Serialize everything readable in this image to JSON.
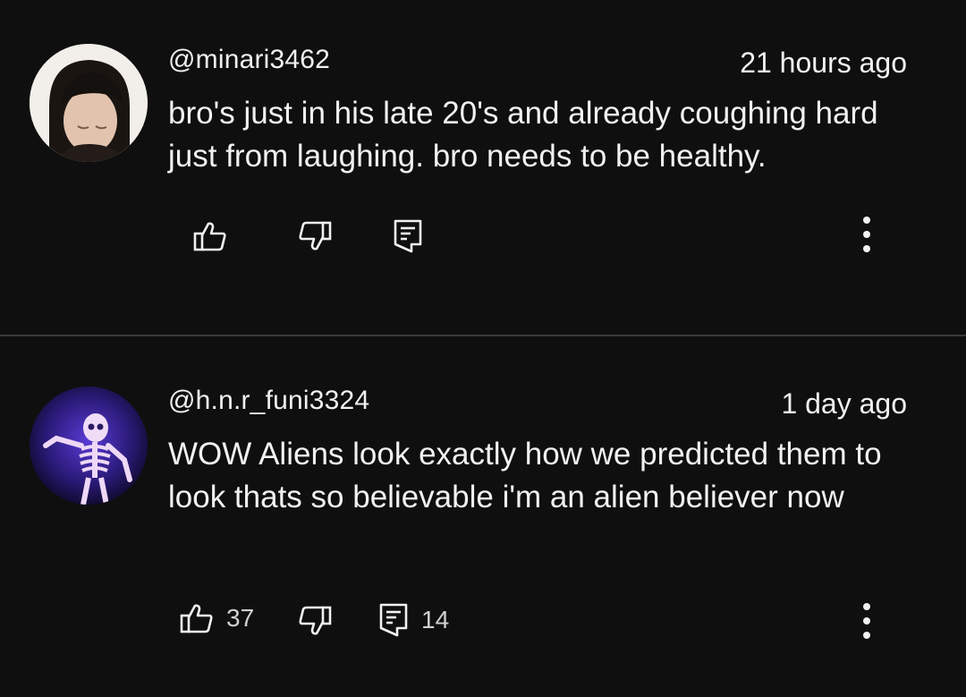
{
  "comments": [
    {
      "username": "@minari3462",
      "time": "21 hours ago",
      "text": "bro's just in his late 20's and already coughing hard just from laughing. bro needs to be healthy.",
      "likes": "",
      "replies": ""
    },
    {
      "username": "@h.n.r_funi3324",
      "time": "1 day ago",
      "text": "WOW Aliens look exactly how we predicted them to look thats so believable i'm an alien believer now",
      "likes": "37",
      "replies": "14"
    }
  ],
  "icons": {
    "like": "thumbs-up-icon",
    "dislike": "thumbs-down-icon",
    "reply": "reply-comment-icon",
    "more": "more-vertical-icon"
  },
  "colors": {
    "background": "#0f0f0f",
    "text": "#f1f1f1",
    "divider": "#3a3a3a"
  }
}
